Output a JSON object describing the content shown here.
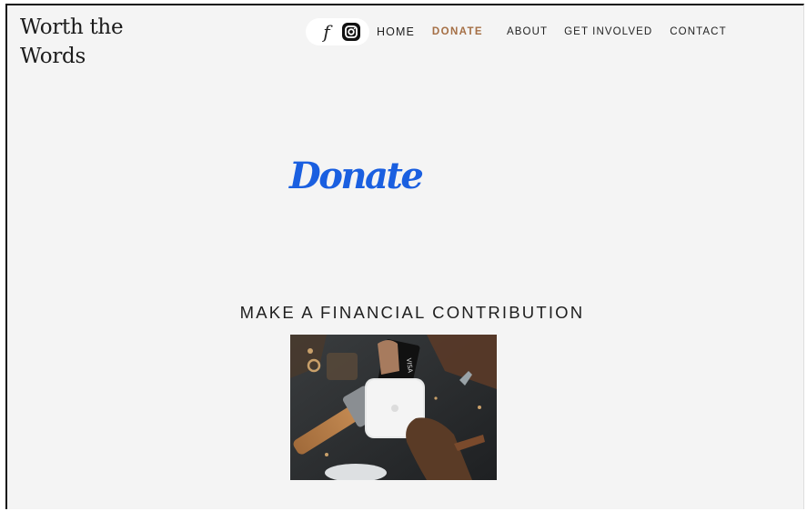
{
  "site": {
    "logo_line1": "Worth the",
    "logo_line2": "Words"
  },
  "social": {
    "facebook_icon": "facebook-icon",
    "instagram_icon": "instagram-icon"
  },
  "nav": {
    "items": [
      {
        "label": "HOME"
      },
      {
        "label": "DONATE",
        "active": true
      },
      {
        "label": "ABOUT"
      },
      {
        "label": "GET INVOLVED"
      },
      {
        "label": "CONTACT"
      }
    ],
    "active_color": "#a56f45"
  },
  "hero": {
    "title": "Donate",
    "title_color": "#1a5fe0"
  },
  "section": {
    "heading": "MAKE A FINANCIAL CONTRIBUTION"
  },
  "photo": {
    "card_text": "VISA"
  }
}
